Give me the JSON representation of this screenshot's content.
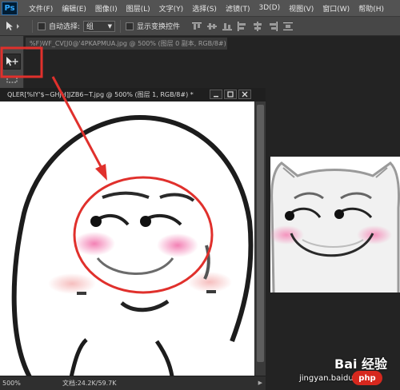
{
  "app": {
    "logo_text": "Ps"
  },
  "menubar": {
    "items": [
      "文件(F)",
      "编辑(E)",
      "图像(I)",
      "图层(L)",
      "文字(Y)",
      "选择(S)",
      "滤镜(T)",
      "3D(D)",
      "视图(V)",
      "窗口(W)",
      "帮助(H)"
    ]
  },
  "options_bar": {
    "tool_icon": "move-tool-icon",
    "auto_select_label": "自动选择:",
    "auto_select_value": "组",
    "show_transform_label": "显示变换控件",
    "auto_select_checked": false,
    "show_transform_checked": false
  },
  "tools": [
    {
      "name": "move-tool",
      "icon": "move-arrow-icon",
      "selected": true
    },
    {
      "name": "marquee-tool",
      "icon": "rect-marquee-icon",
      "selected": false
    }
  ],
  "background_tab": {
    "title": "%F)WF_CV[J0@'4PKAPMUA.jpg @ 500% (图层 0 副本, RGB/8#) *"
  },
  "document": {
    "title": "QLER[%IY'$~GHJH]JZB6~T.jpg @ 500% (图层 1, RGB/8#) *",
    "zoom": "500%",
    "doc_size": "文档:24.2K/59.7K"
  },
  "annotation": {
    "highlight_color": "#e0302c"
  },
  "watermark": {
    "brand": "Bai 经验",
    "site": "jingyan.baidu.com",
    "badge": "php"
  },
  "colors": {
    "menubar_bg": "#535353",
    "options_bg": "#474747",
    "annotation_red": "#e0302c"
  }
}
